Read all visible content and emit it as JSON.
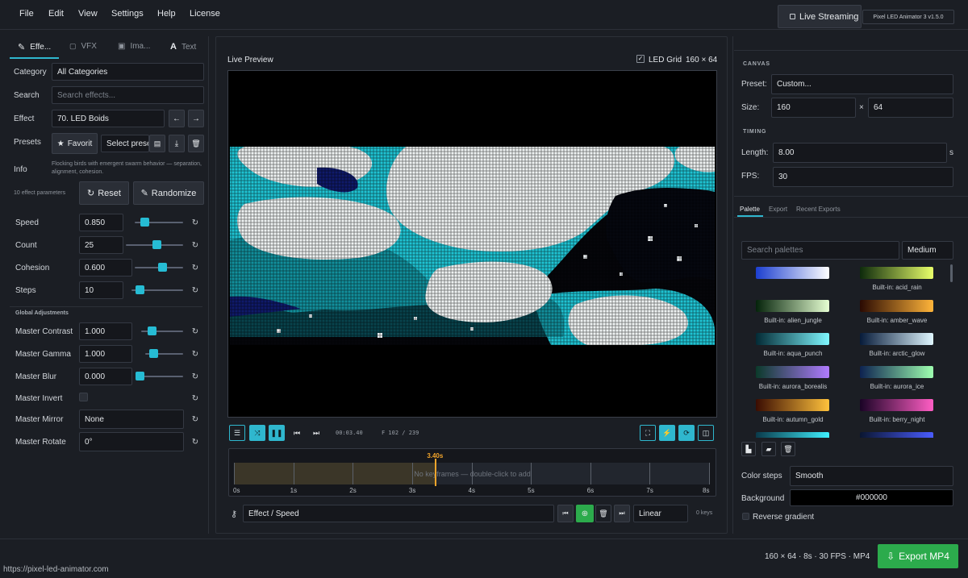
{
  "menu": {
    "file": "File",
    "edit": "Edit",
    "view": "View",
    "settings": "Settings",
    "help": "Help",
    "license": "License"
  },
  "header": {
    "live_streaming": "Live Streaming",
    "app_version": "Pixel LED Animator 3  v1.5.0"
  },
  "left_tabs": {
    "effects": "Effe...",
    "vfx": "VFX",
    "images": "Ima...",
    "text": "Text"
  },
  "left": {
    "category_label": "Category",
    "category_value": "All Categories",
    "search_label": "Search",
    "search_placeholder": "Search effects...",
    "effect_label": "Effect",
    "effect_value": "70. LED Boids",
    "presets_label": "Presets",
    "favorite_label": "Favorit",
    "select_preset": "Select prese",
    "info_label": "Info",
    "info_text": "Flocking birds with emergent swarm behavior — separation, alignment, cohesion.",
    "param_count": "10 effect parameters",
    "reset_label": "Reset",
    "randomize_label": "Randomize",
    "params": [
      {
        "label": "Speed",
        "value": "0.850"
      },
      {
        "label": "Count",
        "value": "25"
      },
      {
        "label": "Cohesion",
        "value": "0.600"
      },
      {
        "label": "Steps",
        "value": "10"
      }
    ],
    "global_title": "Global Adjustments",
    "globals": [
      {
        "label": "Master Contrast",
        "value": "1.000"
      },
      {
        "label": "Master Gamma",
        "value": "1.000"
      },
      {
        "label": "Master Blur",
        "value": "0.000"
      }
    ],
    "master_invert": "Master Invert",
    "master_mirror": "Master Mirror",
    "master_mirror_value": "None",
    "master_rotate": "Master Rotate",
    "master_rotate_value": "0°"
  },
  "slider_levels": {
    "speed": 0.15,
    "count": 0.55,
    "cohesion": 0.6,
    "steps": 0.1,
    "contrast": 0.2,
    "gamma": 0.15,
    "blur": 0.0
  },
  "preview": {
    "title": "Live Preview",
    "led_grid_label": "LED Grid",
    "dimensions": "160 × 64"
  },
  "playback": {
    "time": "00:03.40",
    "frame": "F 102 / 239"
  },
  "timeline": {
    "marker": "3.40s",
    "hint": "No keyframes — double-click to add",
    "ticks": [
      "0s",
      "1s",
      "2s",
      "3s",
      "4s",
      "5s",
      "6s",
      "7s",
      "8s"
    ],
    "position_seconds": 3.4,
    "duration_seconds": 8
  },
  "keyframe_bar": {
    "param": "Effect / Speed",
    "easing": "Linear",
    "keys": "0 keys"
  },
  "right": {
    "canvas_title": "CANVAS",
    "preset_label": "Preset:",
    "preset_value": "Custom...",
    "size_label": "Size:",
    "width": "160",
    "times": "×",
    "height": "64",
    "timing_title": "TIMING",
    "length_label": "Length:",
    "length_value": "8.00",
    "length_unit": "s",
    "fps_label": "FPS:",
    "fps_value": "30",
    "tabs": [
      "Palette",
      "Export",
      "Recent Exports"
    ],
    "palette_search_placeholder": "Search palettes",
    "palette_size": "Medium",
    "palettes": [
      {
        "name": "",
        "c1": "#1c3fd0",
        "c2": "#ffffff"
      },
      {
        "name": "Built-in: acid_rain",
        "c1": "#0d2a0b",
        "c2": "#e8ff6a"
      },
      {
        "name": "Built-in: alien_jungle",
        "c1": "#04230a",
        "c2": "#e6ffd2"
      },
      {
        "name": "Built-in: amber_wave",
        "c1": "#2a0a02",
        "c2": "#ffb43a"
      },
      {
        "name": "Built-in: aqua_punch",
        "c1": "#032a35",
        "c2": "#7ff7ff"
      },
      {
        "name": "Built-in: arctic_glow",
        "c1": "#071b3a",
        "c2": "#dff6ff"
      },
      {
        "name": "Built-in: aurora_borealis",
        "c1": "#0b3a2a",
        "c2": "#b07bff"
      },
      {
        "name": "Built-in: aurora_ice",
        "c1": "#0d2250",
        "c2": "#9effb0"
      },
      {
        "name": "Built-in: autumn_gold",
        "c1": "#3a0c02",
        "c2": "#ffc23c"
      },
      {
        "name": "Built-in: berry_night",
        "c1": "#1a0326",
        "c2": "#ff5ec4"
      },
      {
        "name": "",
        "c1": "#0a3a4a",
        "c2": "#3ff0ff"
      },
      {
        "name": "",
        "c1": "#0a1630",
        "c2": "#4a5cff"
      }
    ],
    "color_steps_label": "Color steps",
    "color_steps_value": "Smooth",
    "background_label": "Background",
    "background_value": "#000000",
    "reverse_label": "Reverse gradient"
  },
  "footer": {
    "summary": "160 × 64 · 8s · 30 FPS · MP4",
    "export_label": "Export MP4",
    "url": "https://pixel-led-animator.com"
  }
}
